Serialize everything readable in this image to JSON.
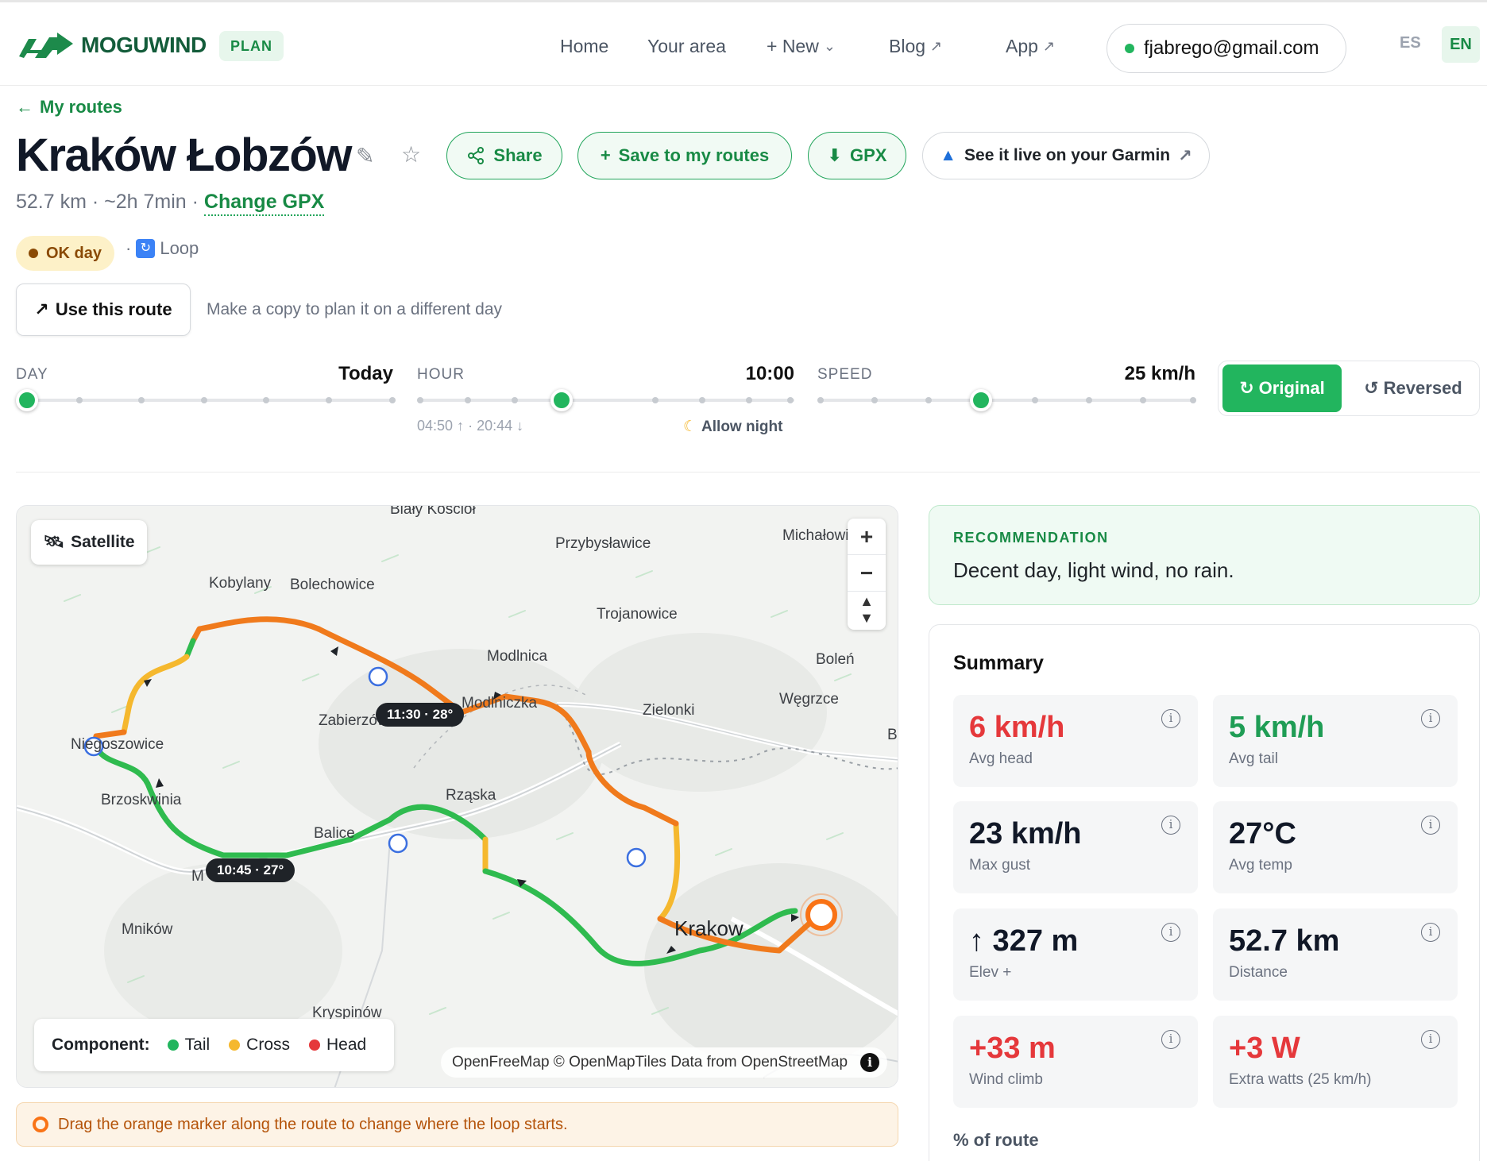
{
  "nav": {
    "brand": "MOGUWIND",
    "plan_badge": "PLAN",
    "links": [
      "Home",
      "Your area",
      "+ New",
      "Blog",
      "App"
    ],
    "account_email": "fjabrego@gmail.com",
    "lang_es": "ES",
    "lang_en": "EN",
    "active_lang": "EN"
  },
  "header": {
    "back_label": "My routes",
    "title": "Kraków Łobzów",
    "share_label": "Share",
    "save_label": "Save to my routes",
    "gpx_label": "GPX",
    "garmin_label": "See it live on your Garmin",
    "distance": "52.7 km",
    "duration": "~2h 7min",
    "change_gpx_label": "Change GPX",
    "day_quality": "OK day",
    "loop_label": "Loop",
    "use_route_label": "Use this route",
    "copy_hint": "Make a copy to plan it on a different day"
  },
  "controls": {
    "day": {
      "label": "DAY",
      "value": "Today",
      "level": 0.0
    },
    "hour": {
      "label": "HOUR",
      "value": "10:00",
      "level": 0.4
    },
    "speed": {
      "label": "SPEED",
      "value": "25 km/h",
      "level": 0.43
    },
    "sunrise": "04:50",
    "sunset": "20:44",
    "allow_night_label": "Allow night",
    "direction_original": "Original",
    "direction_reversed": "Reversed",
    "selected_direction": "Original"
  },
  "map": {
    "satellite_label": "Satellite",
    "places": [
      "Biały Kościół",
      "Przybysławice",
      "Michałowice",
      "Kobylany",
      "Bolechowice",
      "Trojanowice",
      "Modlnica",
      "Boleń",
      "Modlniczka",
      "Zielonki",
      "Węgrzce",
      "Zabierzów",
      "Niegoszowice",
      "Brzoskwinia",
      "Rząska",
      "Balice",
      "Mników",
      "Krakow",
      "Kryspinów",
      "B",
      "M"
    ],
    "time_chips": [
      "11:30 · 28°",
      "10:45 · 27°"
    ],
    "legend_title": "Component:",
    "legend_items": [
      {
        "label": "Tail",
        "color": "#22b55e"
      },
      {
        "label": "Cross",
        "color": "#f5b82e"
      },
      {
        "label": "Head",
        "color": "#e5383b"
      }
    ],
    "attribution": "OpenFreeMap © OpenMapTiles Data from OpenStreetMap",
    "route_colors": {
      "tail": "#2fbb4f",
      "cross": "#f5b82e",
      "head": "#f07a1c"
    },
    "drag_hint": "Drag the orange marker along the route to change where the loop starts."
  },
  "recommendation": {
    "title": "RECOMMENDATION",
    "text": "Decent day, light wind, no rain."
  },
  "summary": {
    "title": "Summary",
    "stats": [
      {
        "value": "6 km/h",
        "label": "Avg head",
        "tone": "red"
      },
      {
        "value": "5 km/h",
        "label": "Avg tail",
        "tone": "green"
      },
      {
        "value": "23 km/h",
        "label": "Max gust",
        "tone": "dark"
      },
      {
        "value": "27°C",
        "label": "Avg temp",
        "tone": "dark"
      },
      {
        "value": "↑ 327 m",
        "label": "Elev +",
        "tone": "dark"
      },
      {
        "value": "52.7 km",
        "label": "Distance",
        "tone": "dark"
      },
      {
        "value": "+33 m",
        "label": "Wind climb",
        "tone": "red"
      },
      {
        "value": "+3 W",
        "label": "Extra watts (25 km/h)",
        "tone": "red"
      }
    ],
    "pct_title": "% of route"
  }
}
